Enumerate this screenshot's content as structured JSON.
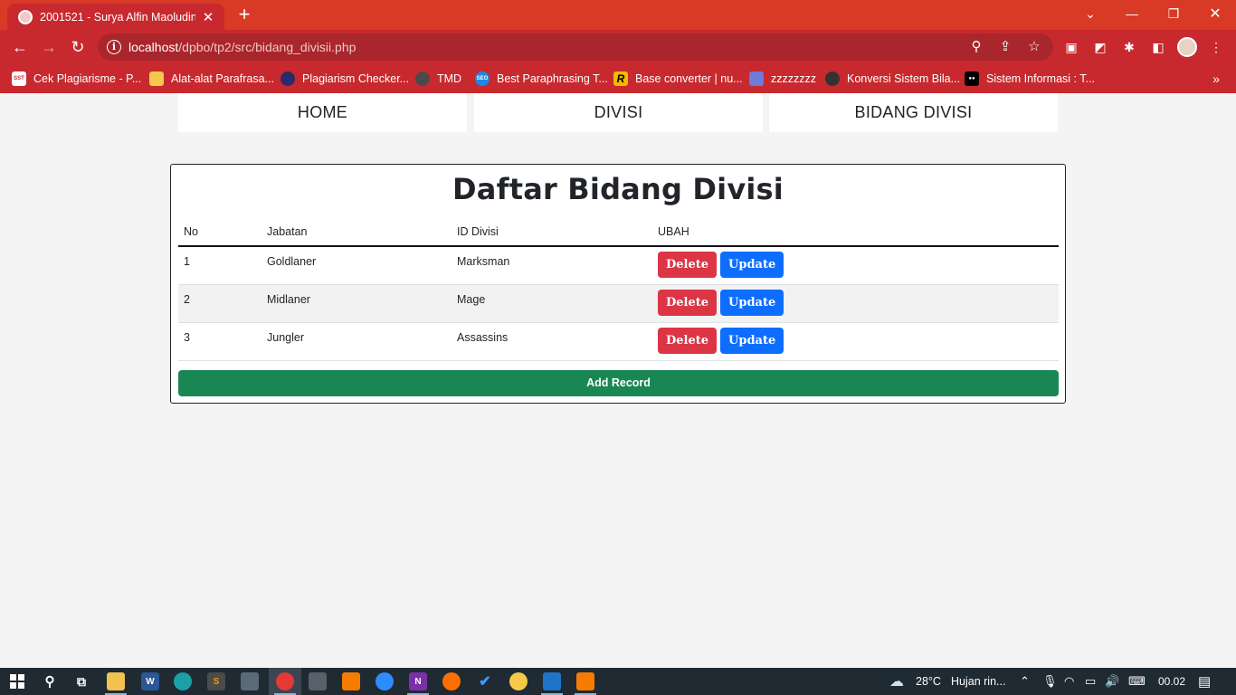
{
  "browser": {
    "tab_title": "2001521 - Surya Alfin Maoludin | ",
    "tab_close": "✕",
    "new_tab": "+",
    "url_host": "localhost",
    "url_path": "/dpbo/tp2/src/bidang_divisii.php",
    "window_controls": {
      "minimize": "—",
      "restore": "❐",
      "close": "✕",
      "tablist": "⌄"
    },
    "bookmarks": [
      {
        "label": "Cek Plagiarisme - P...",
        "icon": "sst-icon",
        "color": "#ffffff",
        "glyph": "SST"
      },
      {
        "label": "Alat-alat Parafrasa...",
        "icon": "quillbot-icon",
        "color": "#f2c94c",
        "glyph": ""
      },
      {
        "label": "Plagiarism Checker...",
        "icon": "plagiarism-icon",
        "color": "#2b2a6b",
        "glyph": ""
      },
      {
        "label": "TMD",
        "icon": "tmd-icon",
        "color": "#4a4a4a",
        "glyph": ""
      },
      {
        "label": "Best Paraphrasing T...",
        "icon": "seo-icon",
        "color": "#1e88e5",
        "glyph": "SEO"
      },
      {
        "label": "Base converter | nu...",
        "icon": "rapidtables-icon",
        "color": "#f5b800",
        "glyph": "R"
      },
      {
        "label": "zzzzzzzz",
        "icon": "layers-icon",
        "color": "#6f7bd9",
        "glyph": ""
      },
      {
        "label": "Konversi Sistem Bila...",
        "icon": "ninja-icon",
        "color": "#333333",
        "glyph": ""
      },
      {
        "label": "Sistem Informasi : T...",
        "icon": "medium-icon",
        "color": "#000000",
        "glyph": "●●"
      }
    ],
    "bookmarks_more": "»"
  },
  "nav": {
    "home": "HOME",
    "divisi": "DIVISI",
    "bidang_divisi": "BIDANG DIVISI"
  },
  "page": {
    "title": "Daftar Bidang Divisi",
    "columns": [
      "No",
      "Jabatan",
      "ID Divisi",
      "UBAH"
    ],
    "rows": [
      {
        "no": "1",
        "jabatan": "Goldlaner",
        "id_divisi": "Marksman"
      },
      {
        "no": "2",
        "jabatan": "Midlaner",
        "id_divisi": "Mage"
      },
      {
        "no": "3",
        "jabatan": "Jungler",
        "id_divisi": "Assassins"
      }
    ],
    "delete_label": "Delete",
    "update_label": "Update",
    "add_label": "Add Record"
  },
  "taskbar": {
    "temperature": "28°C",
    "weather": "Hujan rin...",
    "clock": "00.02"
  },
  "colors": {
    "chrome_red": "#c8292e",
    "delete": "#dc3545",
    "update": "#0d6efd",
    "add": "#198754"
  }
}
